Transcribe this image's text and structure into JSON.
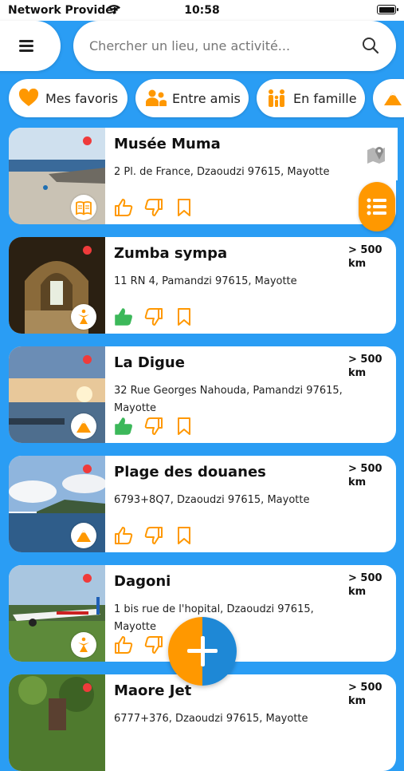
{
  "status_bar": {
    "carrier": "Network Provider",
    "time": "10:58"
  },
  "search": {
    "placeholder": "Chercher un lieu, une activité..."
  },
  "filters": [
    {
      "label": "Mes favoris",
      "icon": "heart-icon"
    },
    {
      "label": "Entre amis",
      "icon": "friends-icon"
    },
    {
      "label": "En famille",
      "icon": "family-icon"
    },
    {
      "label": "",
      "icon": "mountain-icon"
    }
  ],
  "places": [
    {
      "title": "Musée Muma",
      "address": "2 Pl. de France, Dzaoudzi 97615, Mayotte",
      "distance": "",
      "category_icon": "book-icon",
      "liked": false
    },
    {
      "title": "Zumba sympa",
      "address": "11 RN 4, Pamandzi 97615, Mayotte",
      "distance": "> 500 km",
      "category_icon": "dance-icon",
      "liked": true
    },
    {
      "title": "La Digue",
      "address": "32 Rue Georges Nahouda, Pamandzi 97615, Mayotte",
      "distance": "> 500 km",
      "category_icon": "mountain-icon",
      "liked": true
    },
    {
      "title": "Plage des douanes",
      "address": "6793+8Q7, Dzaoudzi 97615, Mayotte",
      "distance": "> 500 km",
      "category_icon": "mountain-icon",
      "liked": false
    },
    {
      "title": "Dagoni",
      "address": "1 bis rue de l'hopital, Dzaoudzi 97615, Mayotte",
      "distance": "> 500 km",
      "category_icon": "dance-icon",
      "liked": false
    },
    {
      "title": "Maore Jet",
      "address": "6777+376, Dzaoudzi 97615, Mayotte",
      "distance": "> 500 km",
      "category_icon": "mountain-icon",
      "liked": false
    }
  ],
  "colors": {
    "background": "#2a9df4",
    "accent": "#ff9800",
    "like_active": "#3cb85a",
    "dot": "#ef3b3b"
  }
}
